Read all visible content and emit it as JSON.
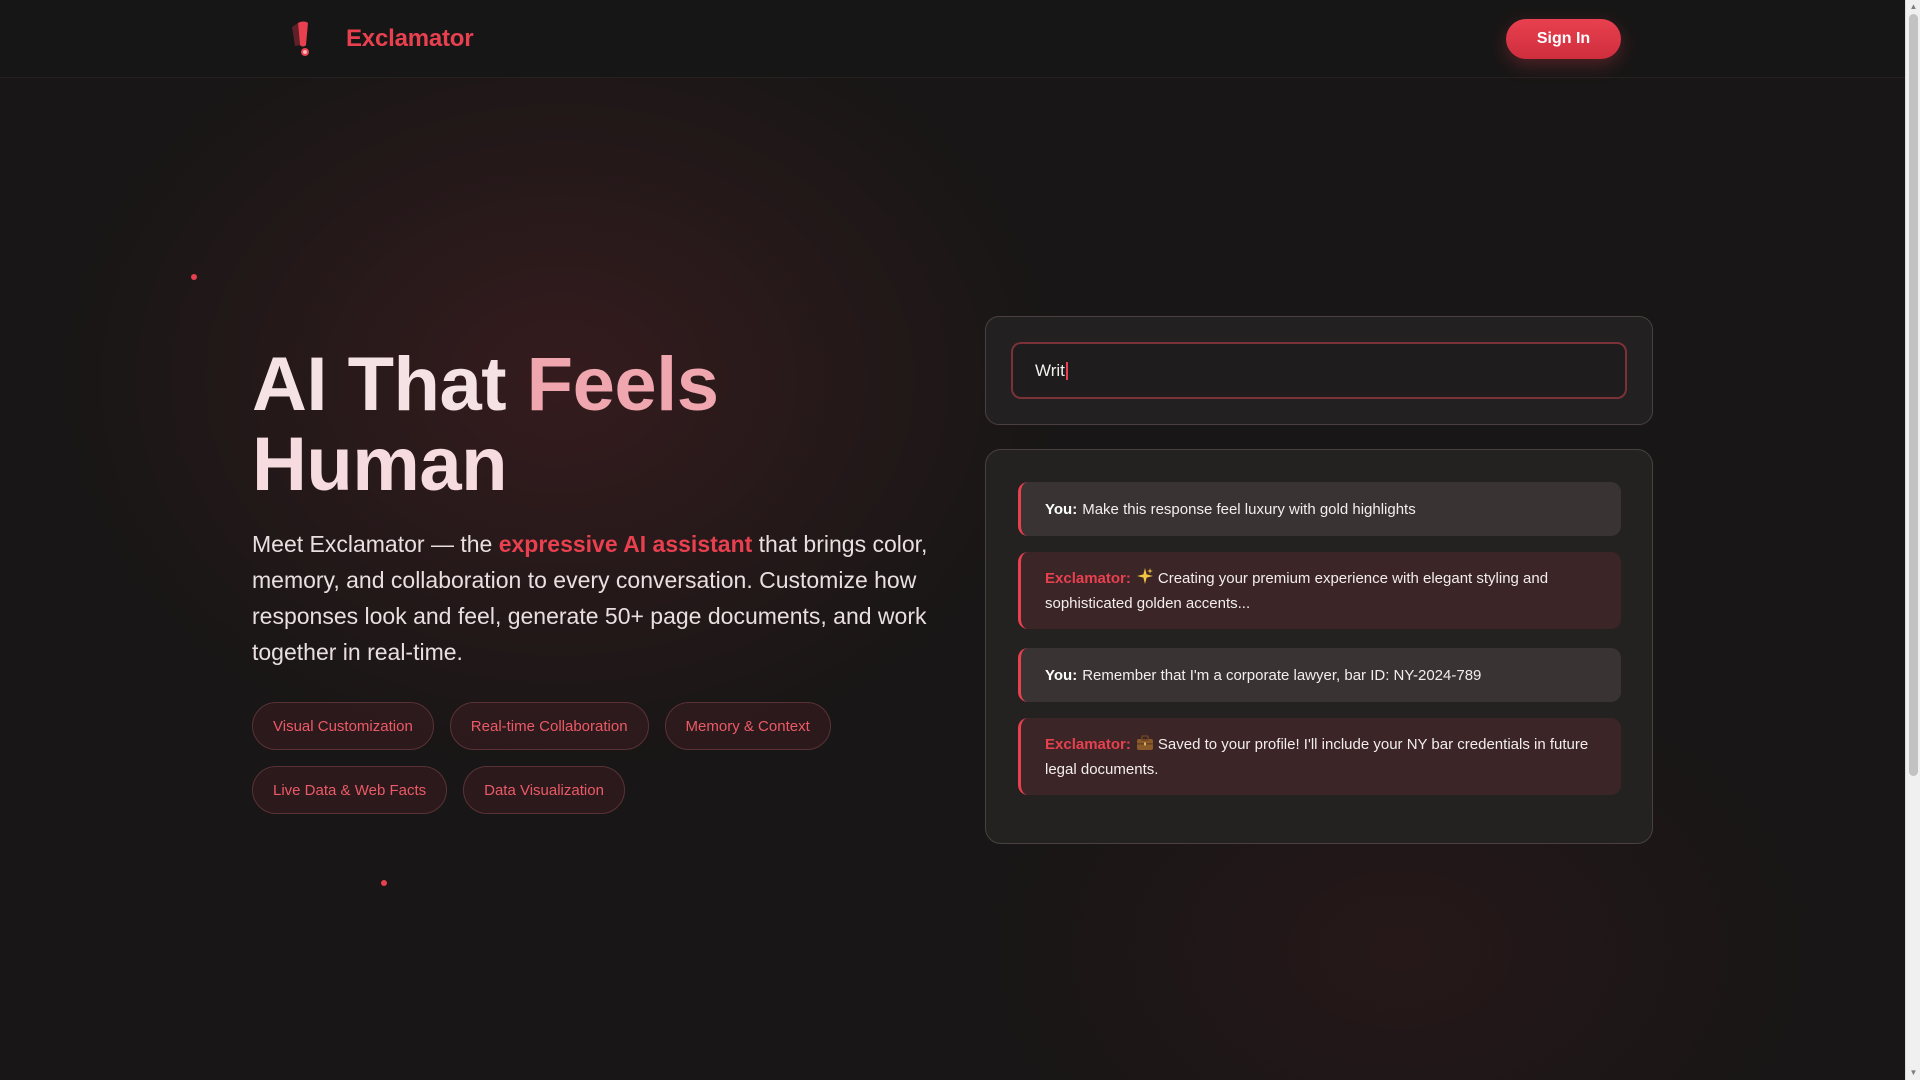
{
  "header": {
    "brand_name": "Exclamator",
    "sign_in_label": "Sign In",
    "logo_icon": "exclamation-icon"
  },
  "hero": {
    "title_part1": "AI That",
    "title_part2": " Feels",
    "title_part3": "Human",
    "desc_before": "Meet Exclamator — the ",
    "desc_highlight": "expressive AI assistant",
    "desc_after": " that brings color, memory, and collaboration to every conversation. Customize how responses look and feel, generate 50+ page documents, and work together in real-time.",
    "tags_row1": [
      "Visual Customization",
      "Real-time Collaboration",
      "Memory & Context"
    ],
    "tags_row2": [
      "Live Data & Web Facts",
      "Data Visualization"
    ]
  },
  "prompt": {
    "typed_value": "Writ"
  },
  "chat": {
    "messages": [
      {
        "speaker": "You:",
        "role": "user",
        "text": "Make this response feel luxury with gold highlights"
      },
      {
        "speaker": "Exclamator:",
        "role": "assistant",
        "emoji": "sparkles-icon",
        "text": "Creating your premium experience with elegant styling and sophisticated golden accents..."
      },
      {
        "speaker": "You:",
        "role": "user",
        "text": "Remember that I'm a corporate lawyer, bar ID: NY-2024-789"
      },
      {
        "speaker": "Exclamator:",
        "role": "assistant",
        "emoji": "briefcase-icon",
        "text": "Saved to your profile! I'll include your NY bar credentials in future legal documents."
      }
    ]
  },
  "colors": {
    "accent": "#e8404f",
    "background": "#181616",
    "card": "#242121"
  }
}
